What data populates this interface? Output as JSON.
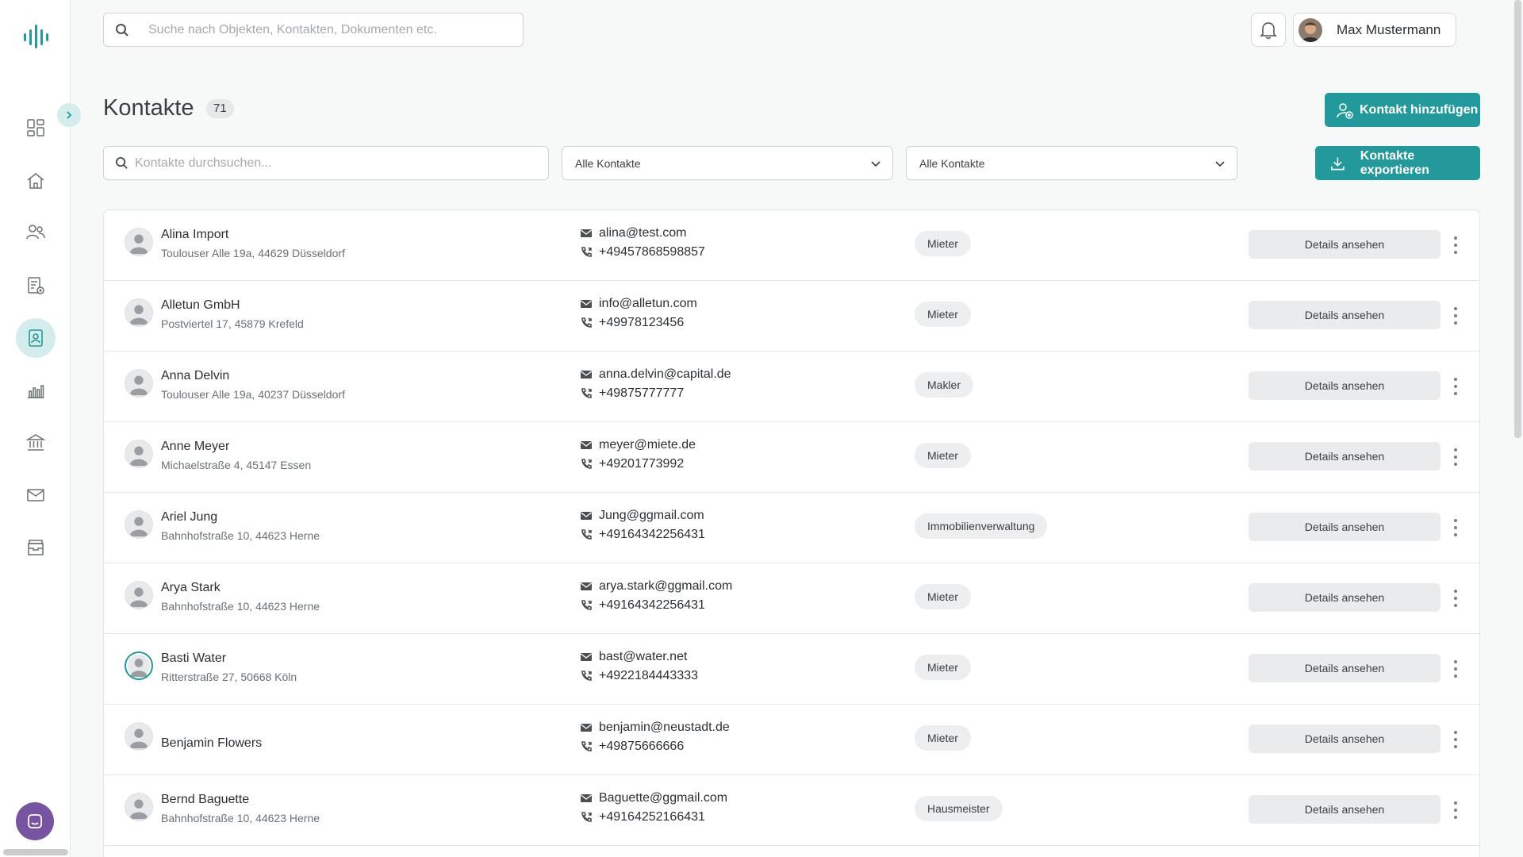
{
  "search": {
    "placeholder": "Suche nach Objekten, Kontakten, Dokumenten etc."
  },
  "user": {
    "name": "Max Mustermann"
  },
  "page": {
    "title": "Kontakte",
    "count": "71"
  },
  "actions": {
    "add_label": "Kontakt hinzufügen",
    "export_label": "Kontakte exportieren"
  },
  "filters": {
    "search_placeholder": "Kontakte durchsuchen...",
    "select1": "Alle Kontakte",
    "select2": "Alle Kontakte"
  },
  "colors": {
    "accent": "#23999b",
    "accent_light": "#d4ecec",
    "chat": "#7654a2"
  },
  "sidebar": {
    "items": [
      {
        "icon": "dashboard-icon"
      },
      {
        "icon": "home-icon"
      },
      {
        "icon": "users-icon"
      },
      {
        "icon": "documents-icon"
      },
      {
        "icon": "contacts-icon",
        "active": true
      },
      {
        "icon": "chart-icon"
      },
      {
        "icon": "bank-icon"
      },
      {
        "icon": "mail-icon"
      },
      {
        "icon": "archive-icon"
      }
    ]
  },
  "contacts": [
    {
      "name": "Alina Import",
      "address": "Toulouser Alle 19a, 44629 Düsseldorf",
      "email": "alina@test.com",
      "phone": "+49457868598857",
      "tag": "Mieter",
      "button": "Details ansehen"
    },
    {
      "name": "Alletun GmbH",
      "address": "Postviertel 17, 45879 Krefeld",
      "email": "info@alletun.com",
      "phone": "+49978123456",
      "tag": "Mieter",
      "button": "Details ansehen"
    },
    {
      "name": "Anna Delvin",
      "address": "Toulouser Alle 19a, 40237 Düsseldorf",
      "email": "anna.delvin@capital.de",
      "phone": "+49875777777",
      "tag": "Makler",
      "button": "Details ansehen"
    },
    {
      "name": "Anne Meyer",
      "address": "Michaelstraße 4, 45147 Essen",
      "email": "meyer@miete.de",
      "phone": "+49201773992",
      "tag": "Mieter",
      "button": "Details ansehen"
    },
    {
      "name": "Ariel Jung",
      "address": "Bahnhofstraße 10, 44623 Herne",
      "email": "Jung@ggmail.com",
      "phone": "+49164342256431",
      "tag": "Immobilienverwaltung",
      "button": "Details ansehen"
    },
    {
      "name": "Arya Stark",
      "address": "Bahnhofstraße 10, 44623 Herne",
      "email": "arya.stark@ggmail.com",
      "phone": "+49164342256431",
      "tag": "Mieter",
      "button": "Details ansehen"
    },
    {
      "name": "Basti Water",
      "address": "Ritterstraße 27, 50668 Köln",
      "email": "bast@water.net",
      "phone": "+4922184443333",
      "tag": "Mieter",
      "button": "Details ansehen"
    },
    {
      "name": "Benjamin Flowers",
      "address": "",
      "email": "benjamin@neustadt.de",
      "phone": "+49875666666",
      "tag": "Mieter",
      "button": "Details ansehen"
    },
    {
      "name": "Bernd Baguette",
      "address": "Bahnhofstraße 10, 44623 Herne",
      "email": "Baguette@ggmail.com",
      "phone": "+49164252166431",
      "tag": "Hausmeister",
      "button": "Details ansehen"
    }
  ]
}
